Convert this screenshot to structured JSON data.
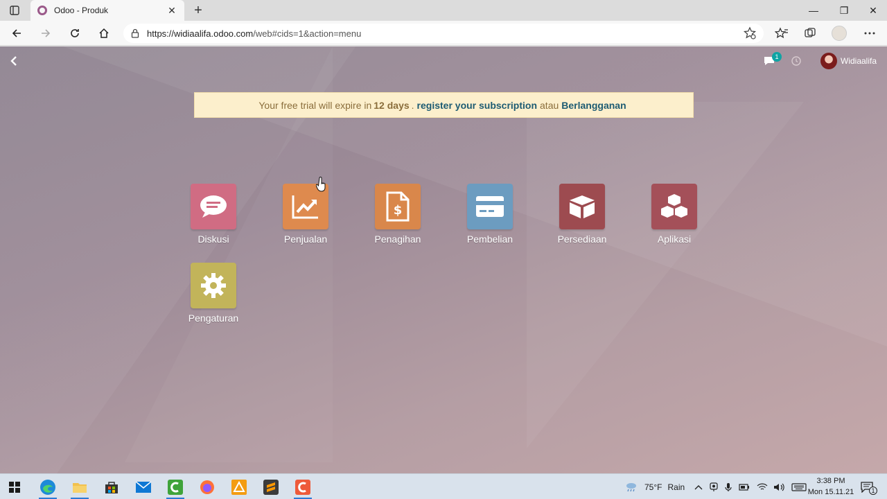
{
  "browser": {
    "tab_title": "Odoo - Produk",
    "tab_close": "✕",
    "new_tab": "+",
    "url_host": "https://widiaalifa.odoo.com",
    "url_path": "/web#cids=1&action=menu",
    "win_minimize": "—",
    "win_restore": "❐",
    "win_close": "✕"
  },
  "odoo": {
    "chat_badge": "1",
    "username": "Widiaalifa",
    "trial": {
      "prefix": "Your free trial will expire in",
      "days": "12 days",
      "dot": ".",
      "register_link": "register your subscription",
      "or": "atau",
      "subscribe_link": "Berlangganan"
    },
    "apps": [
      {
        "label": "Diskusi",
        "color": "#d06c83",
        "icon": "chat-bubble-icon"
      },
      {
        "label": "Penjualan",
        "color": "#de8a4e",
        "icon": "trend-chart-icon"
      },
      {
        "label": "Penagihan",
        "color": "#d9874b",
        "icon": "invoice-dollar-icon"
      },
      {
        "label": "Pembelian",
        "color": "#6c9cc0",
        "icon": "credit-card-icon"
      },
      {
        "label": "Persediaan",
        "color": "#9d4b50",
        "icon": "box-icon"
      },
      {
        "label": "Aplikasi",
        "color": "#a45059",
        "icon": "cubes-icon"
      },
      {
        "label": "Pengaturan",
        "color": "#c2b45a",
        "icon": "gear-icon"
      }
    ]
  },
  "taskbar": {
    "weather_temp": "75°F",
    "weather_text": "Rain",
    "time": "3:38 PM",
    "date": "Mon 15.11.21",
    "notif_count": "1"
  }
}
